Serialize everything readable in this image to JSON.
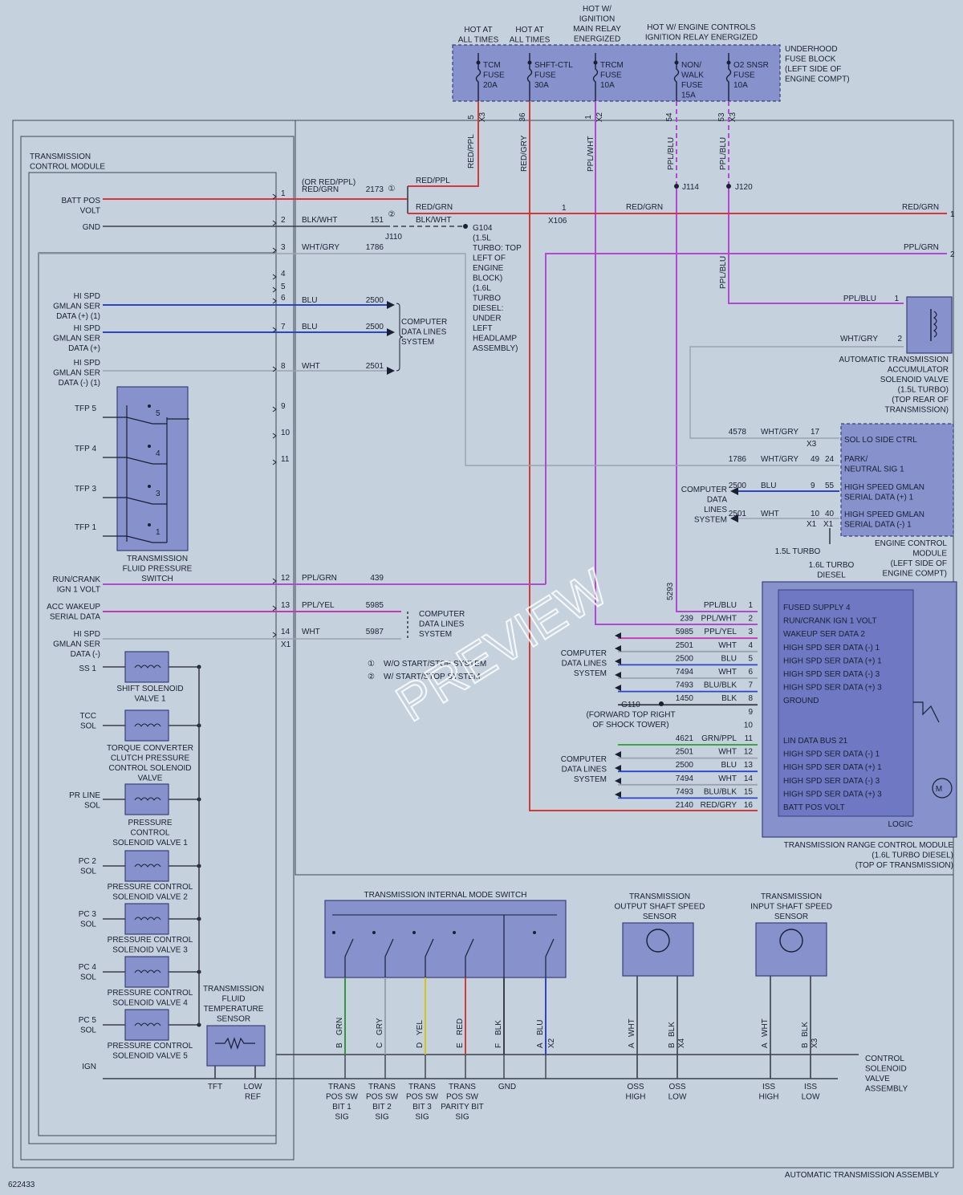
{
  "diagram_id": "622433",
  "assembly_label": "AUTOMATIC TRANSMISSION ASSEMBLY",
  "watermark": "PREVIEW",
  "fuse_block": {
    "label": [
      "UNDERHOOD",
      "FUSE BLOCK",
      "(LEFT SIDE OF",
      "ENGINE COMPT)"
    ],
    "headers": {
      "hot1": [
        "HOT AT",
        "ALL TIMES"
      ],
      "hot2": [
        "HOT AT",
        "ALL TIMES"
      ],
      "hot3": [
        "HOT W/",
        "IGNITION",
        "MAIN RELAY",
        "ENERGIZED"
      ],
      "hot4": [
        "HOT W/ ENGINE CONTROLS",
        "IGNITION RELAY ENERGIZED"
      ]
    },
    "fuses": [
      {
        "name": [
          "TCM",
          "FUSE",
          "20A"
        ],
        "pin": "5",
        "conn": "X3",
        "wire": "RED/PPL"
      },
      {
        "name": [
          "SHFT-CTL",
          "FUSE",
          "30A"
        ],
        "pin": "36",
        "conn": "",
        "wire": "RED/GRY"
      },
      {
        "name": [
          "TRCM",
          "FUSE",
          "10A"
        ],
        "pin": "1",
        "conn": "X2",
        "wire": "PPL/WHT"
      },
      {
        "name": [
          "NON/",
          "WALK",
          "FUSE",
          "15A"
        ],
        "pin": "54",
        "conn": "",
        "wire": "PPL/BLU"
      },
      {
        "name": [
          "O2 SNSR",
          "FUSE",
          "10A"
        ],
        "pin": "53",
        "conn": "X3",
        "wire": "PPL/BLU"
      }
    ]
  },
  "tcm": {
    "title": [
      "TRANSMISSION",
      "CONTROL MODULE"
    ],
    "left_labels": {
      "batt": [
        "BATT POS",
        "VOLT"
      ],
      "gnd": "GND",
      "hs1": [
        "HI SPD",
        "GMLAN SER",
        "DATA (+) (1)"
      ],
      "hs2": [
        "HI SPD",
        "GMLAN SER",
        "DATA (+)"
      ],
      "hs3": [
        "HI SPD",
        "GMLAN SER",
        "DATA (-) (1)"
      ],
      "run": [
        "RUN/CRANK",
        "IGN 1 VOLT"
      ],
      "acc": [
        "ACC WAKEUP",
        "SERIAL DATA"
      ],
      "hs4": [
        "HI SPD",
        "GMLAN SER",
        "DATA (-)"
      ],
      "ss1": "SS 1",
      "tcc": [
        "TCC",
        "SOL"
      ],
      "prline": [
        "PR LINE",
        "SOL"
      ],
      "pc2": [
        "PC 2",
        "SOL"
      ],
      "pc3": [
        "PC 3",
        "SOL"
      ],
      "pc4": [
        "PC 4",
        "SOL"
      ],
      "pc5": [
        "PC 5",
        "SOL"
      ],
      "ign": "IGN"
    },
    "pins": [
      "1",
      "2",
      "3",
      "4",
      "5",
      "6",
      "7",
      "8",
      "9",
      "10",
      "11",
      "12",
      "13",
      "14"
    ],
    "conn": "X1",
    "wires": [
      {
        "pin": "1",
        "color": "RED/GRN",
        "alt": "(OR RED/PPL)",
        "circuit": "2173"
      },
      {
        "pin": "2",
        "color": "BLK/WHT",
        "circuit": "151"
      },
      {
        "pin": "3",
        "color": "WHT/GRY",
        "circuit": "1786"
      },
      {
        "pin": "6",
        "color": "BLU",
        "circuit": "2500"
      },
      {
        "pin": "7",
        "color": "BLU",
        "circuit": "2500"
      },
      {
        "pin": "8",
        "color": "WHT",
        "circuit": "2501"
      },
      {
        "pin": "12",
        "color": "PPL/GRN",
        "circuit": "439"
      },
      {
        "pin": "13",
        "color": "PPL/YEL",
        "circuit": "5985"
      },
      {
        "pin": "14",
        "color": "WHT",
        "circuit": "5987"
      }
    ]
  },
  "tfp": {
    "label": [
      "TRANSMISSION",
      "FLUID PRESSURE",
      "SWITCH"
    ],
    "switches": [
      "TFP 5",
      "TFP 4",
      "TFP 3",
      "TFP 1"
    ],
    "nums": [
      "5",
      "4",
      "3",
      "1"
    ]
  },
  "solenoids": [
    [
      "SHIFT SOLENOID",
      "VALVE 1"
    ],
    [
      "TORQUE CONVERTER",
      "CLUTCH PRESSURE",
      "CONTROL SOLENOID",
      "VALVE"
    ],
    [
      "PRESSURE",
      "CONTROL",
      "SOLENOID VALVE 1"
    ],
    [
      "PRESSURE CONTROL",
      "SOLENOID VALVE 2"
    ],
    [
      "PRESSURE CONTROL",
      "SOLENOID VALVE 3"
    ],
    [
      "PRESSURE CONTROL",
      "SOLENOID VALVE 4"
    ],
    [
      "PRESSURE CONTROL",
      "SOLENOID VALVE 5"
    ]
  ],
  "tft": {
    "label": [
      "TRANSMISSION",
      "FLUID",
      "TEMPERATURE",
      "SENSOR"
    ],
    "pins": [
      "TFT",
      "LOW",
      "REF"
    ]
  },
  "splices": {
    "red_ppl": "RED/PPL",
    "red_grn": "RED/GRN",
    "blk_wht": "BLK/WHT",
    "j110": "J110",
    "x106_pin": "1",
    "x106": "X106",
    "j114": "J114",
    "j120": "J120",
    "right_red_grn": "RED/GRN",
    "right_ppl_grn": "PPL/GRN",
    "right1": "1",
    "right2": "2",
    "ppl_blu": "PPL/BLU",
    "c1": "①",
    "c2": "②"
  },
  "g104": [
    "G104",
    "(1.5L",
    "TURBO: TOP",
    "LEFT OF",
    "ENGINE",
    "BLOCK)",
    "(1.6L",
    "TURBO",
    "DIESEL:",
    "UNDER",
    "LEFT",
    "HEADLAMP",
    "ASSEMBLY)"
  ],
  "cdl1": [
    "COMPUTER",
    "DATA LINES",
    "SYSTEM"
  ],
  "cdl2": [
    "COMPUTER",
    "DATA LINES",
    "SYSTEM"
  ],
  "notes": [
    "W/O START/STOP SYSTEM",
    "W/ START/STOP SYSTEM"
  ],
  "accum": {
    "label": [
      "AUTOMATIC TRANSMISSION",
      "ACCUMULATOR",
      "SOLENOID VALVE",
      "(1.5L TURBO)",
      "(TOP REAR OF",
      "TRANSMISSION)"
    ],
    "pin1": "1",
    "pin1_wire": "PPL/BLU",
    "pin2": "2",
    "pin2_wire": "WHT/GRY"
  },
  "ecm": {
    "label": [
      "ENGINE CONTROL",
      "MODULE",
      "(LEFT SIDE OF",
      "ENGINE COMPT)"
    ],
    "rows": [
      {
        "circuit": "4578",
        "wire": "WHT/GRY",
        "pin": "17",
        "text": "SOL LO SIDE CTRL"
      },
      {
        "circuit": "1786",
        "wire": "WHT/GRY",
        "pin": "49",
        "pin2": "24",
        "text": "PARK/ NEUTRAL SIG 1"
      },
      {
        "circuit": "2500",
        "wire": "BLU",
        "pin": "9",
        "pin2": "55",
        "text": "HIGH SPEED GMLAN SERIAL DATA (+) 1"
      },
      {
        "circuit": "2501",
        "wire": "WHT",
        "pin": "10",
        "pin2": "40",
        "text": "HIGH SPEED GMLAN SERIAL DATA (-) 1"
      }
    ],
    "x3": "X3",
    "x1a": "X1",
    "x1b": "X1",
    "cdl": [
      "COMPUTER",
      "DATA",
      "LINES",
      "SYSTEM"
    ],
    "turbo15": "1.5L TURBO",
    "diesel16": [
      "1.6L TURBO",
      "DIESEL"
    ]
  },
  "trcm": {
    "label": [
      "TRANSMISSION RANGE CONTROL MODULE",
      "(1.6L TURBO DIESEL)",
      "(TOP OF TRANSMISSION)"
    ],
    "logic": "LOGIC",
    "circuit_5293": "5293",
    "pins": [
      {
        "pin": "1",
        "circuit": "",
        "wire": "PPL/BLU",
        "text": "FUSED SUPPLY 4"
      },
      {
        "pin": "2",
        "circuit": "239",
        "wire": "PPL/WHT",
        "text": "RUN/CRANK IGN 1 VOLT"
      },
      {
        "pin": "3",
        "circuit": "5985",
        "wire": "PPL/YEL",
        "text": "WAKEUP SER DATA 2"
      },
      {
        "pin": "4",
        "circuit": "2501",
        "wire": "WHT",
        "text": "HIGH SPD SER DATA (-) 1"
      },
      {
        "pin": "5",
        "circuit": "2500",
        "wire": "BLU",
        "text": "HIGH SPD SER DATA (+) 1"
      },
      {
        "pin": "6",
        "circuit": "7494",
        "wire": "WHT",
        "text": "HIGH SPD SER DATA (-) 3"
      },
      {
        "pin": "7",
        "circuit": "7493",
        "wire": "BLU/BLK",
        "text": "HIGH SPD SER DATA (+) 3"
      },
      {
        "pin": "8",
        "circuit": "1450",
        "wire": "BLK",
        "text": "GROUND"
      },
      {
        "pin": "9",
        "circuit": "",
        "wire": "",
        "text": ""
      },
      {
        "pin": "10",
        "circuit": "",
        "wire": "",
        "text": ""
      },
      {
        "pin": "11",
        "circuit": "4621",
        "wire": "GRN/PPL",
        "text": "LIN DATA BUS 21"
      },
      {
        "pin": "12",
        "circuit": "2501",
        "wire": "WHT",
        "text": "HIGH SPD SER DATA (-) 1"
      },
      {
        "pin": "13",
        "circuit": "2500",
        "wire": "BLU",
        "text": "HIGH SPD SER DATA (+) 1"
      },
      {
        "pin": "14",
        "circuit": "7494",
        "wire": "WHT",
        "text": "HIGH SPD SER DATA (-) 3"
      },
      {
        "pin": "15",
        "circuit": "7493",
        "wire": "BLU/BLK",
        "text": "HIGH SPD SER DATA (+) 3"
      },
      {
        "pin": "16",
        "circuit": "2140",
        "wire": "RED/GRY",
        "text": "BATT POS VOLT"
      }
    ],
    "g110": [
      "G110",
      "(FORWARD TOP RIGHT",
      "OF SHOCK TOWER)"
    ],
    "cdl_a": [
      "COMPUTER",
      "DATA LINES",
      "SYSTEM"
    ],
    "cdl_b": [
      "COMPUTER",
      "DATA LINES",
      "SYSTEM"
    ],
    "motor": "M"
  },
  "mode_switch": {
    "label": "TRANSMISSION INTERNAL MODE SWITCH",
    "pins": [
      {
        "letter": "B",
        "wire": "GRN",
        "color": "#2f9a3a"
      },
      {
        "letter": "C",
        "wire": "GRY",
        "color": "#9aa3ad"
      },
      {
        "letter": "D",
        "wire": "YEL",
        "color": "#d8c21a"
      },
      {
        "letter": "E",
        "wire": "RED",
        "color": "#d23a3a"
      },
      {
        "letter": "F",
        "wire": "BLK",
        "color": "#3b3f4a"
      },
      {
        "letter": "A",
        "wire": "BLU",
        "color": "#2a45c8"
      }
    ],
    "conn": "X2",
    "bottom": [
      [
        "TRANS",
        "POS SW",
        "BIT 1",
        "SIG"
      ],
      [
        "TRANS",
        "POS SW",
        "BIT 2",
        "SIG"
      ],
      [
        "TRANS",
        "POS SW",
        "BIT 3",
        "SIG"
      ],
      [
        "TRANS",
        "POS SW",
        "PARITY BIT",
        "SIG"
      ],
      [
        "GND"
      ]
    ]
  },
  "oss": {
    "label": [
      "TRANSMISSION",
      "OUTPUT SHAFT SPEED",
      "SENSOR"
    ],
    "pins": [
      {
        "letter": "A",
        "wire": "WHT"
      },
      {
        "letter": "B",
        "wire": "BLK"
      }
    ],
    "conn": "X4",
    "bottom": [
      [
        "OSS",
        "HIGH"
      ],
      [
        "OSS",
        "LOW"
      ]
    ]
  },
  "iss": {
    "label": [
      "TRANSMISSION",
      "INPUT SHAFT SPEED",
      "SENSOR"
    ],
    "pins": [
      {
        "letter": "A",
        "wire": "WHT"
      },
      {
        "letter": "B",
        "wire": "BLK"
      }
    ],
    "conn": "X3",
    "bottom": [
      [
        "ISS",
        "HIGH"
      ],
      [
        "ISS",
        "LOW"
      ]
    ]
  },
  "csva": [
    "CONTROL",
    "SOLENOID",
    "VALVE",
    "ASSEMBLY"
  ],
  "colors": {
    "red": "#d23a3a",
    "purple": "#b04ad0",
    "magenta": "#c23ab0",
    "blue": "#2a45c8",
    "gray": "#9aa3ad",
    "black": "#3b3f4a",
    "green": "#2f9a3a",
    "brown": "#8a6a3a",
    "box": "#8791cc",
    "background": "#c6d1de"
  }
}
